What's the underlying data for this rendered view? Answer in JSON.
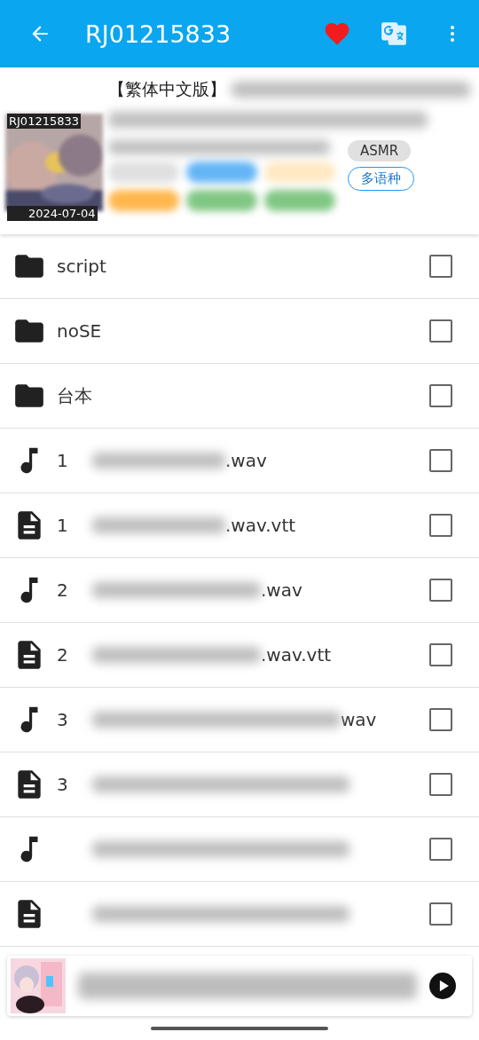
{
  "header": {
    "title": "RJ01215833",
    "favorited": true
  },
  "work": {
    "code": "RJ01215833",
    "date": "2024-07-04",
    "title": "【繁体中文版】",
    "tags": [
      {
        "label": "ASMR",
        "kind": "filled"
      },
      {
        "label": "多语种",
        "kind": "outlined"
      }
    ],
    "hidden_tags": [
      {
        "color": "#e0e0e0"
      },
      {
        "color": "#64b5f6"
      },
      {
        "color": "#ffe9c4"
      },
      {
        "color": "#ffb74d"
      },
      {
        "color": "#81c784"
      },
      {
        "color": "#81c784"
      }
    ]
  },
  "files": [
    {
      "kind": "folder",
      "name": "script",
      "checked": false
    },
    {
      "kind": "folder",
      "name": "noSE",
      "checked": false
    },
    {
      "kind": "folder",
      "name": "台本",
      "checked": false
    },
    {
      "kind": "audio",
      "number": "1",
      "suffix": ".wav",
      "checked": false
    },
    {
      "kind": "subtitle",
      "number": "1",
      "suffix": ".wav.vtt",
      "checked": false
    },
    {
      "kind": "audio",
      "number": "2",
      "suffix": ".wav",
      "checked": false
    },
    {
      "kind": "subtitle",
      "number": "2",
      "suffix": ".wav.vtt",
      "checked": false
    },
    {
      "kind": "audio",
      "number": "3",
      "suffix": "wav",
      "checked": false
    },
    {
      "kind": "subtitle",
      "number": "3",
      "checked": false
    },
    {
      "kind": "audio",
      "checked": false
    },
    {
      "kind": "subtitle",
      "checked": false
    }
  ]
}
